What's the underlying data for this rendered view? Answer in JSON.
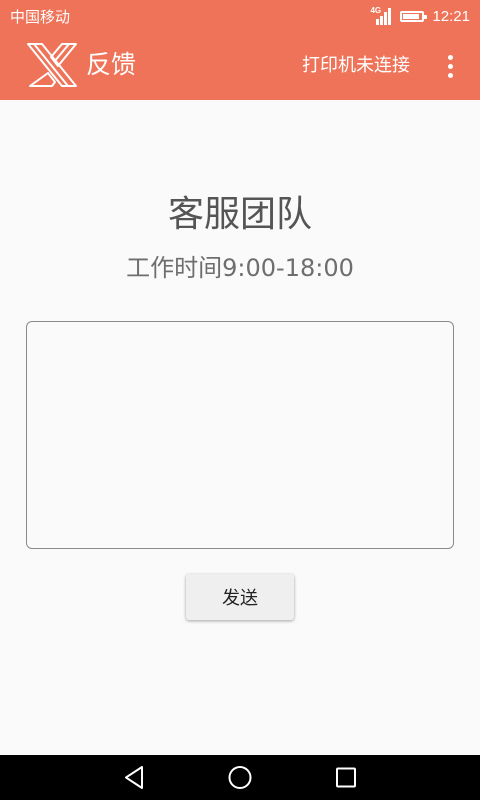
{
  "status_bar": {
    "carrier": "中国移动",
    "network": "4G",
    "time": "12:21",
    "battery_level": 0.85
  },
  "app_bar": {
    "title": "反馈",
    "printer_status": "打印机未连接",
    "logo_icon": "x-logo-icon",
    "menu_icon": "overflow-menu-icon",
    "background_color": "#ef7358"
  },
  "content": {
    "team_title": "客服团队",
    "work_hours": "工作时间9:00-18:00",
    "feedback_value": "",
    "feedback_placeholder": ""
  },
  "actions": {
    "send_label": "发送"
  },
  "nav_bar": {
    "back_icon": "back-triangle-icon",
    "home_icon": "home-circle-icon",
    "recents_icon": "recents-square-icon"
  }
}
